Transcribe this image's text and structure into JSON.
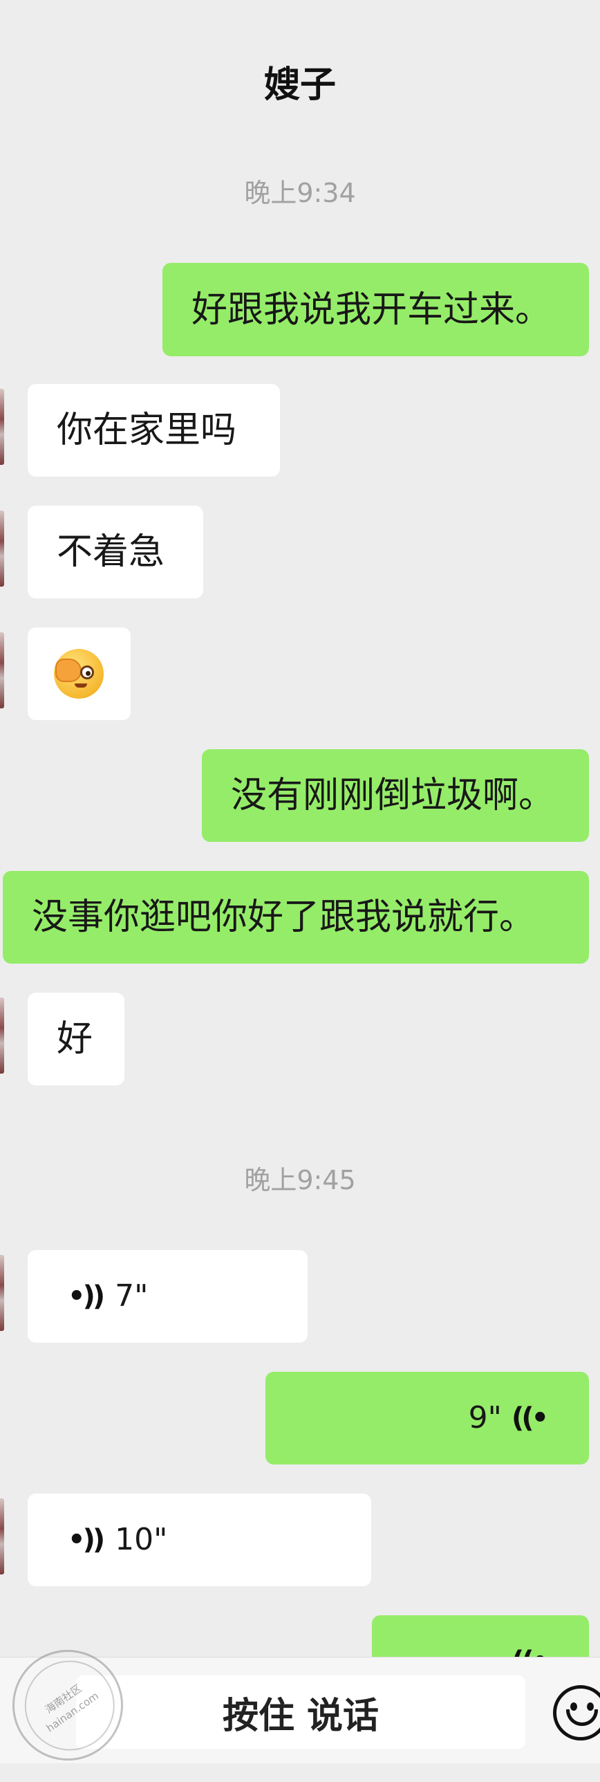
{
  "header": {
    "title": "嫂子"
  },
  "messages": {
    "time_1": "晚上9:34",
    "m1": "好跟我说我开车过来。",
    "m2": "你在家里吗",
    "m3": "不着急",
    "m4_emoji": "face-with-hand-over-eye-icon",
    "m5": "没有刚刚倒垃圾啊。",
    "m6": "没事你逛吧你好了跟我说就行。",
    "m7": "好",
    "time_2": "晚上9:45",
    "voice_1": "7\"",
    "voice_2": "9\"",
    "voice_3": "10\""
  },
  "input_bar": {
    "talk_button_label": "按住 说话",
    "emoji_icon": "smiley-icon"
  },
  "watermark": {
    "line1": "海南社区",
    "line2": "hainan.com"
  },
  "colors": {
    "background": "#ededed",
    "incoming_bubble": "#ffffff",
    "outgoing_bubble": "#95ec69",
    "timestamp": "#a1a1a1"
  }
}
